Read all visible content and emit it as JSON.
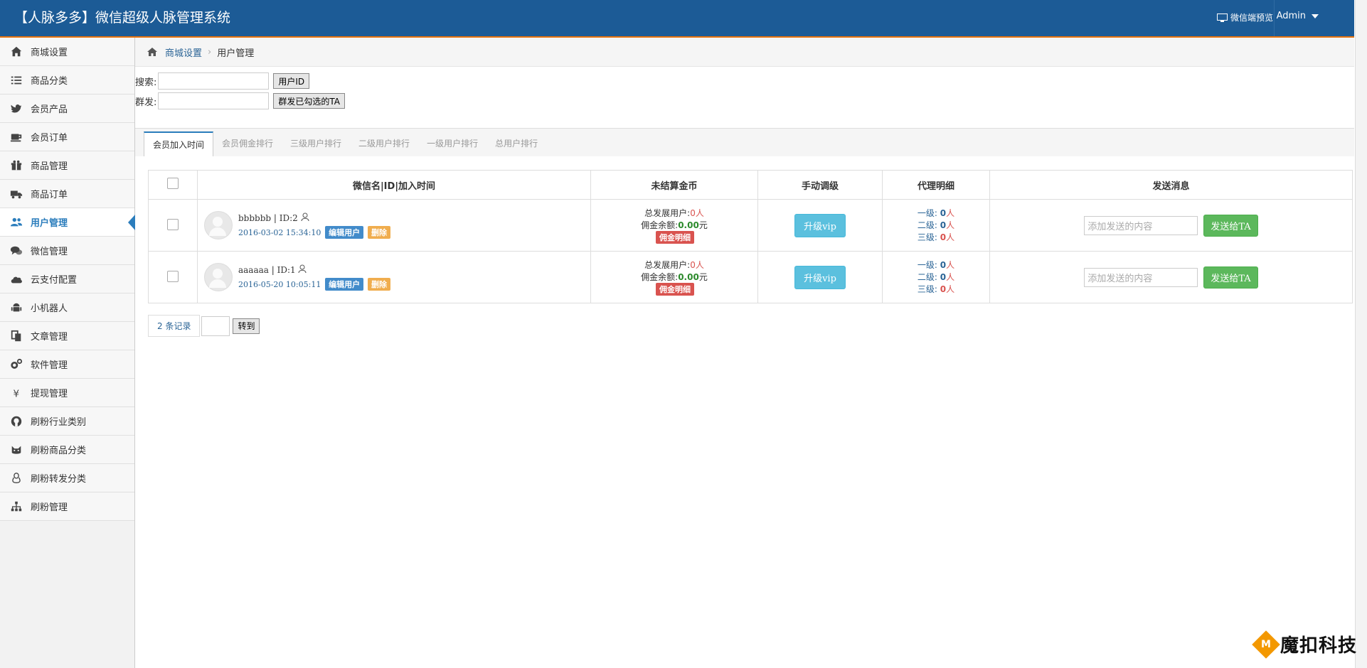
{
  "header": {
    "title": "【人脉多多】微信超级人脉管理系统",
    "preview_label": "微信端预览",
    "user_label": "Admin"
  },
  "sidebar": {
    "items": [
      {
        "label": "商城设置",
        "icon": "home-icon"
      },
      {
        "label": "商品分类",
        "icon": "list-icon"
      },
      {
        "label": "会员产品",
        "icon": "twitter-bird-icon"
      },
      {
        "label": "会员订单",
        "icon": "coffee-icon"
      },
      {
        "label": "商品管理",
        "icon": "gift-icon"
      },
      {
        "label": "商品订单",
        "icon": "truck-icon"
      },
      {
        "label": "用户管理",
        "icon": "users-icon",
        "active": true
      },
      {
        "label": "微信管理",
        "icon": "comments-icon"
      },
      {
        "label": "云支付配置",
        "icon": "cloud-icon"
      },
      {
        "label": "小机器人",
        "icon": "android-icon"
      },
      {
        "label": "文章管理",
        "icon": "files-icon"
      },
      {
        "label": "软件管理",
        "icon": "gears-icon"
      },
      {
        "label": "提现管理",
        "icon": "yen-icon"
      },
      {
        "label": "刷粉行业类别",
        "icon": "github-icon"
      },
      {
        "label": "刷粉商品分类",
        "icon": "cat-icon"
      },
      {
        "label": "刷粉转发分类",
        "icon": "linux-icon"
      },
      {
        "label": "刷粉管理",
        "icon": "sitemap-icon"
      }
    ]
  },
  "breadcrumb": {
    "root": "商城设置",
    "current": "用户管理"
  },
  "search": {
    "search_label": "搜索:",
    "search_button": "用户ID",
    "bulk_label": "群发:",
    "bulk_button": "群发已勾选的TA"
  },
  "tabs": [
    "会员加入时间",
    "会员佣金排行",
    "三级用户排行",
    "二级用户排行",
    "一级用户排行",
    "总用户排行"
  ],
  "table": {
    "headers": [
      "微信名|ID|加入时间",
      "未结算金币",
      "手动调级",
      "代理明细",
      "发送消息"
    ],
    "rows": [
      {
        "name": "bbbbbb",
        "id": "ID:2",
        "date": "2016-03-02 15:34:10",
        "edit": "编辑用户",
        "delete": "删除",
        "dev_label": "总发展用户:",
        "dev_count": "0",
        "dev_unit": "人",
        "balance_label": "佣金余额:",
        "balance": "0.00",
        "balance_unit": "元",
        "commission": "佣金明细",
        "upgrade": "升级vip",
        "l1_label": "一级:",
        "l1": "0",
        "l2_label": "二级:",
        "l2": "0",
        "l3_label": "三级:",
        "l3": "0",
        "unit": "人",
        "msg_placeholder": "添加发送的内容",
        "send": "发送给TA"
      },
      {
        "name": "aaaaaa",
        "id": "ID:1",
        "date": "2016-05-20 10:05:11",
        "edit": "编辑用户",
        "delete": "删除",
        "dev_label": "总发展用户:",
        "dev_count": "0",
        "dev_unit": "人",
        "balance_label": "佣金余额:",
        "balance": "0.00",
        "balance_unit": "元",
        "commission": "佣金明细",
        "upgrade": "升级vip",
        "l1_label": "一级:",
        "l1": "0",
        "l2_label": "二级:",
        "l2": "0",
        "l3_label": "三级:",
        "l3": "0",
        "unit": "人",
        "msg_placeholder": "添加发送的内容",
        "send": "发送给TA"
      }
    ]
  },
  "pager": {
    "count": "2 条记录",
    "go": "转到"
  },
  "watermark": {
    "logo": "M",
    "text": "魔扣科技"
  },
  "colors": {
    "header": "#1c5b96",
    "accent": "#e8730e",
    "active": "#2b7dbc"
  }
}
